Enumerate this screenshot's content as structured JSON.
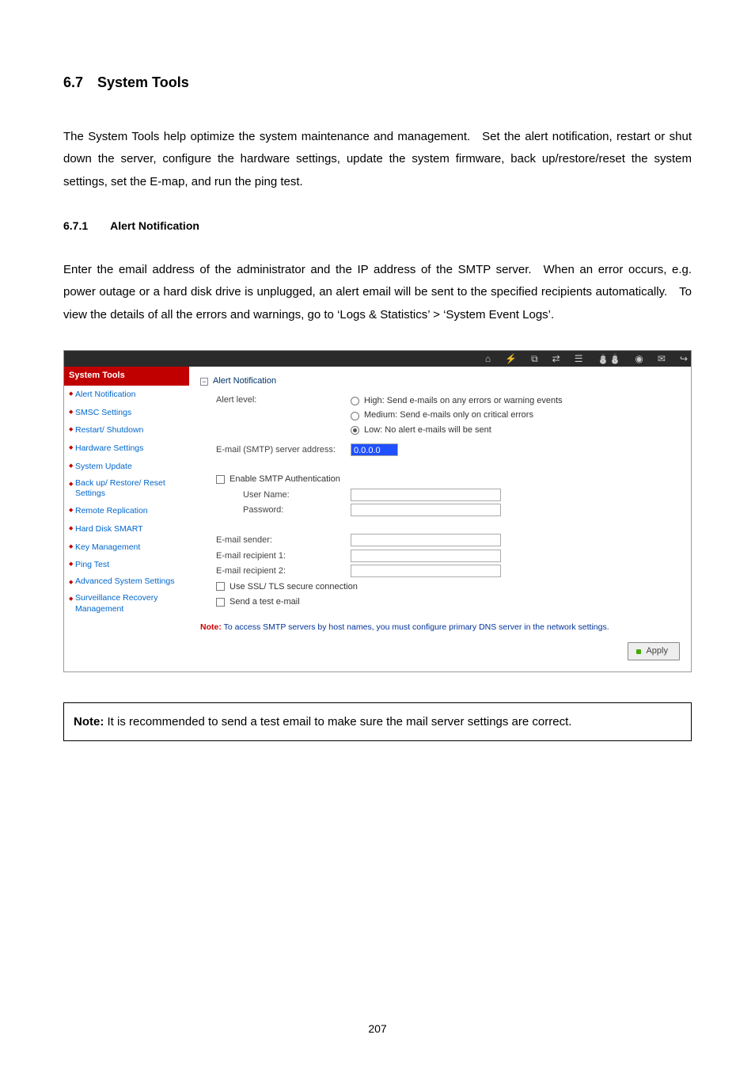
{
  "doc": {
    "section_title": "6.7 System Tools",
    "intro": "The System Tools help optimize the system maintenance and management. Set the alert notification, restart or shut down the server, configure the hardware settings, update the system firmware, back up/restore/reset the system settings, set the E-map, and run the ping test.",
    "subsection_title": "6.7.1  Alert Notification",
    "subsection_body": "Enter the email address of the administrator and the IP address of the SMTP server. When an error occurs, e.g. power outage or a hard disk drive is unplugged, an alert email will be sent to the specified recipients automatically. To view the details of all the errors and warnings, go to ‘Logs & Statistics’ > ‘System Event Logs’.",
    "note_label": "Note:",
    "note_text": " It is recommended to send a test email to make sure the mail server settings are correct.",
    "page_number": "207"
  },
  "ui": {
    "topbar_icons": [
      "home-icon",
      "lightning-icon",
      "sliders-icon",
      "transfer-icon",
      "list-icon",
      "users-icon",
      "camera-icon",
      "mail-icon",
      "logout-icon"
    ],
    "sidebar": {
      "header": "System Tools",
      "items": [
        "Alert Notification",
        "SMSC Settings",
        "Restart/ Shutdown",
        "Hardware Settings",
        "System Update",
        "Back up/ Restore/ Reset Settings",
        "Remote Replication",
        "Hard Disk SMART",
        "Key Management",
        "Ping Test",
        "Advanced System Settings",
        "Surveillance Recovery Management"
      ]
    },
    "content": {
      "panel_title": "Alert Notification",
      "alert_level_label": "Alert level:",
      "alert_levels": [
        "High: Send e-mails on any errors or warning events",
        "Medium: Send e-mails only on critical errors",
        "Low: No alert e-mails will be sent"
      ],
      "alert_level_selected_index": 2,
      "smtp_label": "E-mail (SMTP) server address:",
      "smtp_value": "0.0.0.0",
      "enable_auth": "Enable SMTP Authentication",
      "user_name_label": "User Name:",
      "password_label": "Password:",
      "sender_label": "E-mail sender:",
      "recip1_label": "E-mail recipient 1:",
      "recip2_label": "E-mail recipient 2:",
      "ssl_label": "Use SSL/ TLS secure connection",
      "test_label": "Send a test e-mail",
      "note_prefix": "Note:",
      "note_body": " To access SMTP servers by host names, you must configure primary DNS server in the network settings.",
      "apply_label": "Apply"
    }
  }
}
